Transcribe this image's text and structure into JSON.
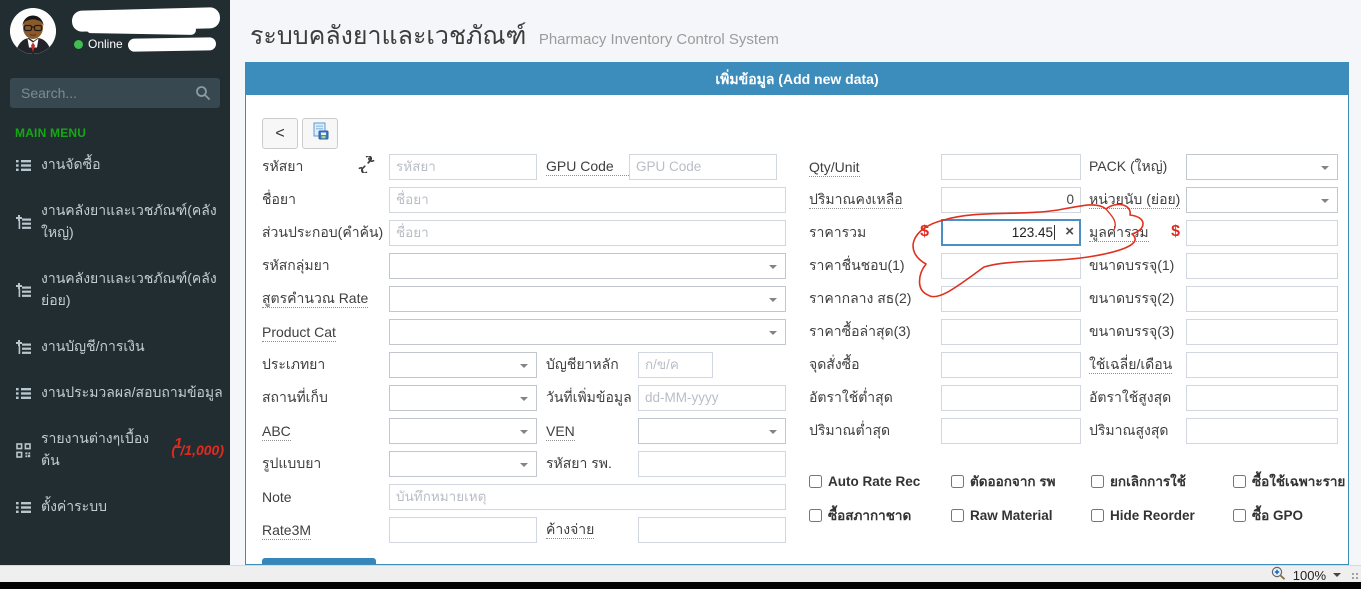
{
  "sidebar": {
    "user": {
      "status": "Online"
    },
    "search_placeholder": "Search...",
    "menu_header": "MAIN MENU",
    "items": [
      {
        "label": "งานจัดซื้อ",
        "icon": "list-icon"
      },
      {
        "label": "งานคลังยาและเวชภัณฑ์(คลังใหญ่)",
        "icon": "tree-icon"
      },
      {
        "label": "งานคลังยาและเวชภัณฑ์(คลังย่อย)",
        "icon": "tree-icon"
      },
      {
        "label": "งานบัญชี/การเงิน",
        "icon": "tree-icon"
      },
      {
        "label": "งานประมวลผล/สอบถามข้อมูล",
        "icon": "list-icon"
      },
      {
        "label": "รายงานต่างๆเบื้องต้น",
        "icon": "qrcode-icon",
        "badge_pre": "(",
        "badge_sup": "1",
        "badge_post": "/1,000)"
      },
      {
        "label": "ตั้งค่าระบบ",
        "icon": "list-icon"
      }
    ]
  },
  "header": {
    "title_th": "ระบบคลังยาและเวชภัณฑ์",
    "title_en": "Pharmacy Inventory Control System"
  },
  "panel": {
    "title": "เพิ่มข้อมูล (Add new data)"
  },
  "toolbar": {
    "back": "<"
  },
  "form": {
    "left": [
      {
        "label": "รหัสยา",
        "placeholder": "รหัสยา",
        "label2": "GPU Code",
        "placeholder2": "GPU Code"
      },
      {
        "label": "ชื่อยา",
        "placeholder": "ชื่อยา"
      },
      {
        "label": "ส่วนประกอบ(คำค้น)",
        "placeholder": "ชื่อยา"
      },
      {
        "label": "รหัสกลุ่มยา"
      },
      {
        "label": "สูตรคำนวณ Rate"
      },
      {
        "label": "Product Cat"
      },
      {
        "label": "ประเภทยา",
        "label2": "บัญชียาหลัก",
        "placeholder2": "ก/ข/ค"
      },
      {
        "label": "สถานที่เก็บ",
        "label2": "วันที่เพิ่มข้อมูล",
        "placeholder2": "dd-MM-yyyy"
      },
      {
        "label": "ABC",
        "label2": "VEN"
      },
      {
        "label": "รูปแบบยา",
        "label2": "รหัสยา รพ."
      },
      {
        "label": "Note",
        "placeholder": "บันทึกหมายเหตุ"
      },
      {
        "label": "Rate3M",
        "label2": "ค้างจ่าย"
      }
    ],
    "right": [
      {
        "label": "Qty/Unit",
        "label2": "PACK (ใหญ่)"
      },
      {
        "label": "ปริมาณคงเหลือ",
        "value": "0",
        "label2": "หน่วยนับ (ย่อย)"
      },
      {
        "label": "ราคารวม",
        "currency": "$",
        "value": "123.45",
        "clear": "×",
        "label2": "มูลค่ารวม",
        "currency2": "$"
      },
      {
        "label": "ราคาชื่นชอบ(1)",
        "label2": "ขนาดบรรจุ(1)"
      },
      {
        "label": "ราคากลาง สธ(2)",
        "label2": "ขนาดบรรจุ(2)"
      },
      {
        "label": "ราคาซื้อล่าสุด(3)",
        "label2": "ขนาดบรรจุ(3)"
      },
      {
        "label": "จุดสั่งซื้อ",
        "label2": "ใช้เฉลี่ย/เดือน"
      },
      {
        "label": "อัตราใช้ต่ำสุด",
        "label2": "อัตราใช้สูงสุด"
      },
      {
        "label": "ปริมาณต่ำสุด",
        "label2": "ปริมาณสูงสุด"
      }
    ],
    "checkboxes": [
      "Auto Rate Rec",
      "ตัดออกจาก รพ",
      "ยกเลิกการใช้",
      "ซื้อใช้เฉพาะราย",
      "ซื้อสภากาชาด",
      "Raw Material",
      "Hide Reorder",
      "ซื้อ GPO"
    ]
  },
  "statusbar": {
    "zoom_level": "100%"
  },
  "icons": {
    "search": "magnifier",
    "broken_link": "chain-broken",
    "save": "file-save",
    "back": "chevron-left",
    "dropdown": "caret-down",
    "clear": "x",
    "currency": "dollar",
    "zoom": "magnifier-plus"
  },
  "colors": {
    "accent_blue": "#3c8dbc",
    "sidebar_bg": "#222d32",
    "menu_green": "#15a715",
    "annotation_red": "#e02b20",
    "focus_blue": "#4b8fc4",
    "online_green": "#3fbf4d"
  }
}
